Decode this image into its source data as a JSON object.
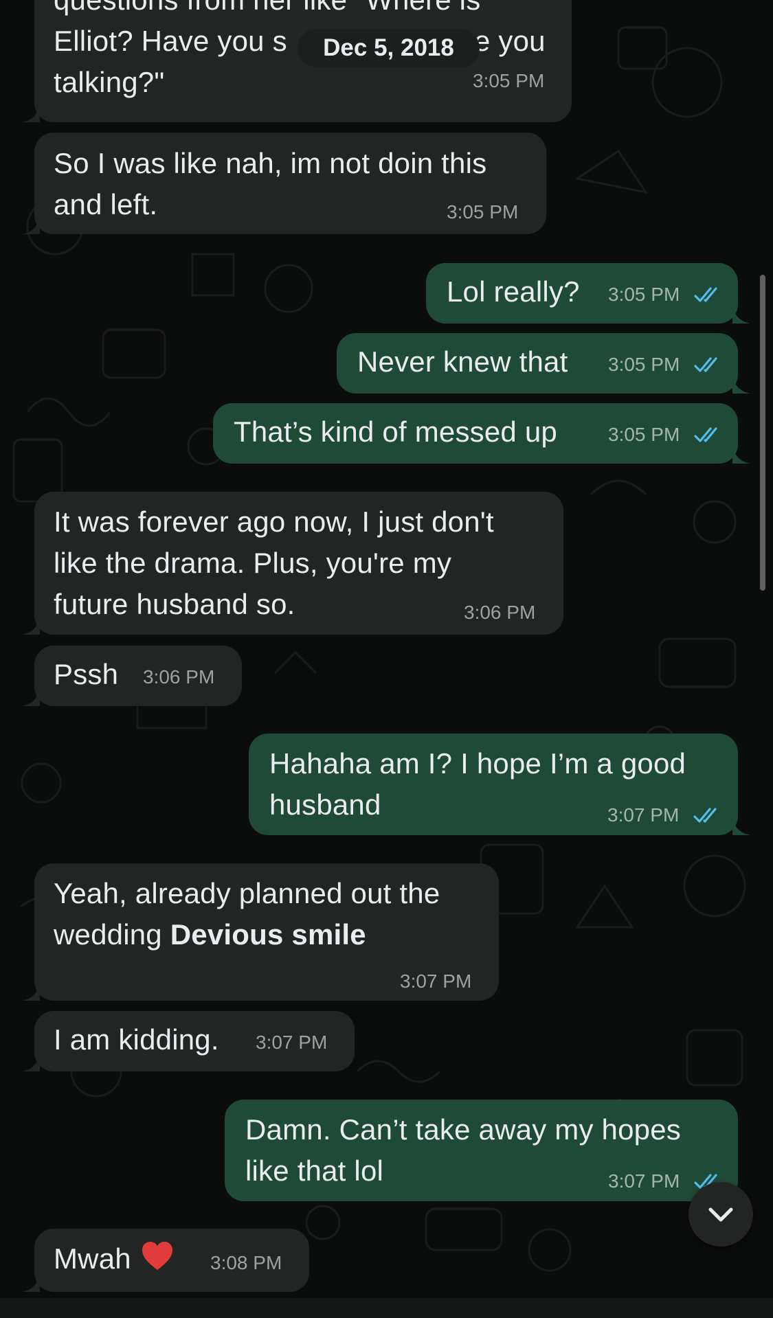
{
  "date_chip": "Dec 5, 2018",
  "messages": [
    {
      "direction": "in",
      "lines": [
        "questions from her like \"Where is",
        "Elliot? Have you s",
        "talking?\""
      ],
      "partial_tail": "e you",
      "time": "3:05 PM"
    },
    {
      "direction": "in",
      "lines": [
        "So I was like nah, im not doin this",
        "and left."
      ],
      "time": "3:05 PM"
    },
    {
      "direction": "out",
      "lines": [
        "Lol really?"
      ],
      "time": "3:05 PM",
      "status": "read"
    },
    {
      "direction": "out",
      "lines": [
        "Never knew that"
      ],
      "time": "3:05 PM",
      "status": "read"
    },
    {
      "direction": "out",
      "lines": [
        "That’s kind of messed up"
      ],
      "time": "3:05 PM",
      "status": "read"
    },
    {
      "direction": "in",
      "lines": [
        "It was forever ago now, I just don't",
        "like the drama. Plus, you're my",
        "future husband so."
      ],
      "time": "3:06 PM"
    },
    {
      "direction": "in",
      "lines": [
        "Pssh"
      ],
      "time": "3:06 PM"
    },
    {
      "direction": "out",
      "lines": [
        "Hahaha am I? I hope I’m a good",
        "husband"
      ],
      "time": "3:07 PM",
      "status": "read"
    },
    {
      "direction": "in",
      "lines": [
        "Yeah, already planned out the",
        "wedding "
      ],
      "bold_suffix": "Devious smile",
      "time": "3:07 PM"
    },
    {
      "direction": "in",
      "lines": [
        "I am kidding."
      ],
      "time": "3:07 PM"
    },
    {
      "direction": "out",
      "lines": [
        "Damn. Can’t take away my hopes",
        "like that lol"
      ],
      "time": "3:07 PM",
      "status": "read"
    },
    {
      "direction": "in",
      "lines": [
        "Mwah "
      ],
      "emoji": "heart",
      "time": "3:08 PM"
    }
  ],
  "colors": {
    "incoming_bubble": "#232525",
    "outgoing_bubble": "#1f4a38",
    "read_ticks": "#53bdeb",
    "background": "#0b0c0c"
  },
  "icons": {
    "scroll_down": "chevron-down-icon",
    "read_receipt": "double-check-icon"
  }
}
